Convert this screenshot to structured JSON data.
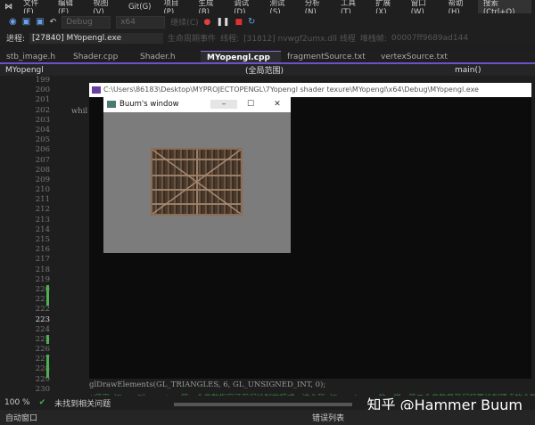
{
  "menu": {
    "items": [
      "文件(F)",
      "编辑(E)",
      "视图(V)",
      "Git(G)",
      "项目(P)",
      "生成(B)",
      "调试(D)",
      "测试(S)",
      "分析(N)",
      "工具(T)",
      "扩展(X)",
      "窗口(W)",
      "帮助(H)"
    ],
    "search": "搜索 (Ctrl+Q)"
  },
  "toolbar": {
    "config": "Debug",
    "platform": "x64",
    "continue": "继续(C)"
  },
  "process": {
    "label": "进程:",
    "value": "[27840] MYopengl.exe",
    "lifecycle": "生命周期事件",
    "thread_label": "线程:",
    "thread": "[31812] nvwgf2umx.dll 线程",
    "stack_label": "堆栈帧:",
    "stack": "00007ff9689ad144"
  },
  "tabs": [
    "stb_image.h",
    "Shader.cpp",
    "Shader.h",
    "MYopengl.cpp",
    "fragmentSource.txt",
    "vertexSource.txt"
  ],
  "nav": {
    "project": "MYopengl",
    "scope": "(全局范围)",
    "func": "main()"
  },
  "lines": [
    "199",
    "200",
    "201",
    "202",
    "203",
    "204",
    "205",
    "206",
    "207",
    "208",
    "209",
    "210",
    "211",
    "212",
    "213",
    "214",
    "215",
    "216",
    "217",
    "218",
    "219",
    "220",
    "221",
    "222",
    "223",
    "224",
    "225",
    "226",
    "227",
    "228",
    "229",
    "230"
  ],
  "code": {
    "while": "whil",
    "draw": "glDrawElements(GL_TRIANGLES, 6, GL_UNSIGNED_INT, 0);",
    "comment": "//使用glDrawElements，第一个参数指定了我们绘制的模式，这个和glDrawArrays的一样。第二个参数是我们打算绘制顶点的个数"
  },
  "console": {
    "title": "C:\\Users\\86183\\Desktop\\MYPROJECTOPENGL\\7Yopengl shader texure\\MYopengl\\x64\\Debug\\MYopengl.exe"
  },
  "glwindow": {
    "title": "Buum's window",
    "min": "–",
    "max": "☐",
    "close": "✕"
  },
  "status": {
    "zoom": "100 %",
    "issues": "未找到相关问题"
  },
  "bottom": {
    "left": "自动窗口",
    "right": "错误列表"
  },
  "watermark": "知乎 @Hammer Buum"
}
